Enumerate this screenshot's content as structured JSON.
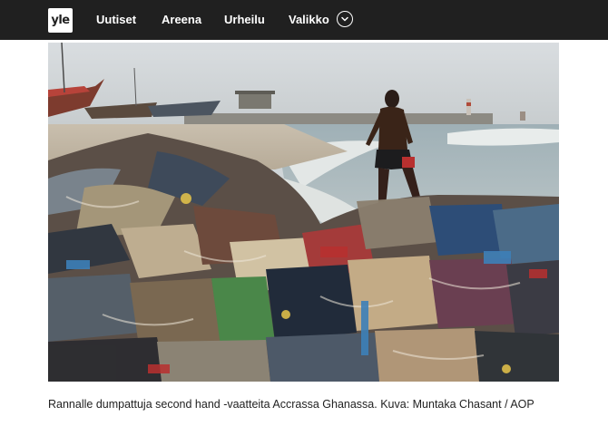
{
  "header": {
    "logo_text": "yle",
    "nav": [
      {
        "label": "Uutiset"
      },
      {
        "label": "Areena"
      },
      {
        "label": "Urheilu"
      },
      {
        "label": "Valikko"
      }
    ],
    "menu_icon": "chevron-down-circle-icon",
    "background": "#202020"
  },
  "article": {
    "caption": "Rannalle dumpattuja second hand -vaatteita Accrassa Ghanassa. Kuva: Muntaka Chasant / AOP"
  }
}
